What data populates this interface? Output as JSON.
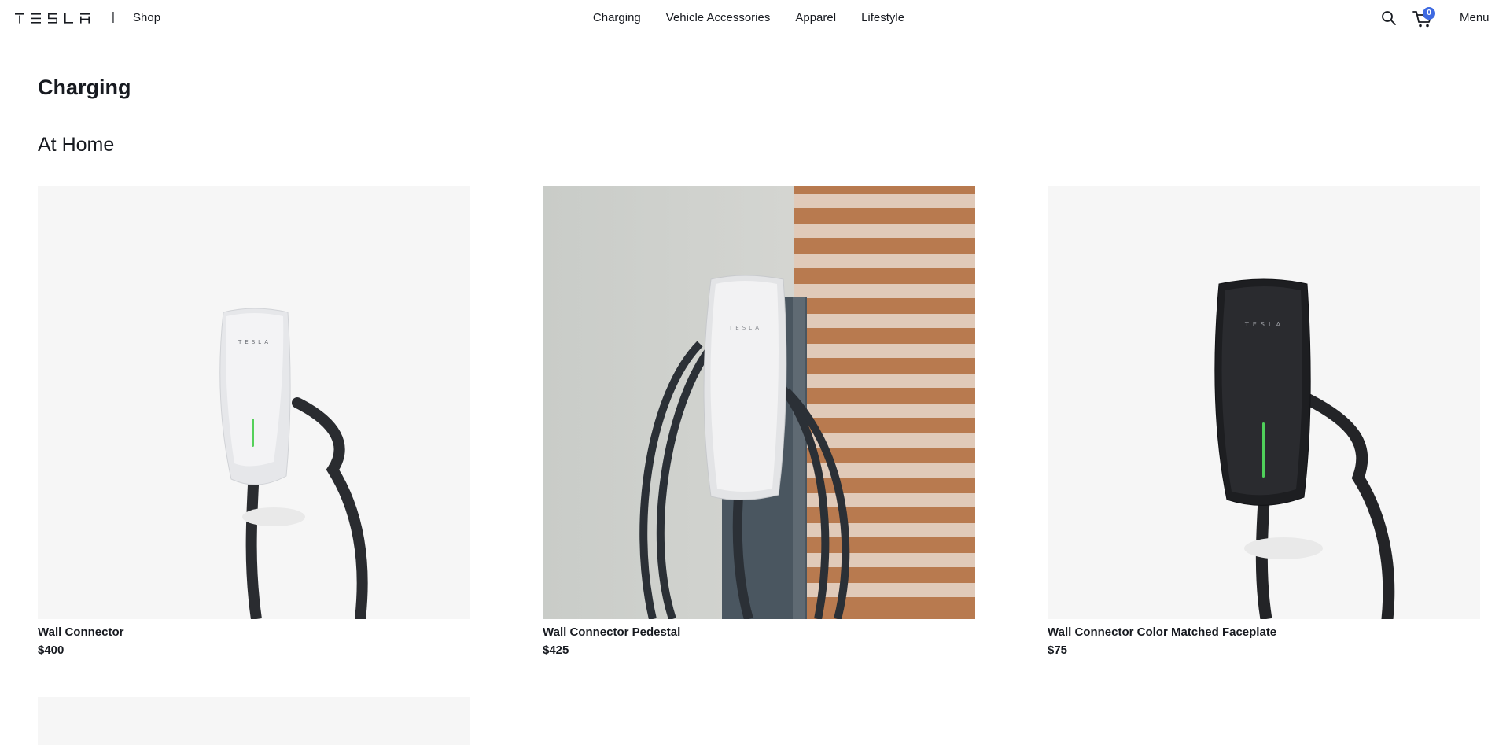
{
  "header": {
    "logo": "TESLA",
    "divider": "|",
    "shop_label": "Shop",
    "nav": [
      {
        "label": "Charging"
      },
      {
        "label": "Vehicle Accessories"
      },
      {
        "label": "Apparel"
      },
      {
        "label": "Lifestyle"
      }
    ],
    "search_icon": "search-icon",
    "cart_icon": "cart-icon",
    "cart_count": "0",
    "menu_label": "Menu"
  },
  "page": {
    "title": "Charging",
    "section_title": "At Home"
  },
  "products": [
    {
      "name": "Wall Connector",
      "price": "$400",
      "image": "white-wall-connector"
    },
    {
      "name": "Wall Connector Pedestal",
      "price": "$425",
      "image": "wall-connector-pedestal"
    },
    {
      "name": "Wall Connector Color Matched Faceplate",
      "price": "$75",
      "image": "black-wall-connector"
    }
  ],
  "colors": {
    "text": "#171a20",
    "accent": "#3e6ae1",
    "card_bg": "#f6f6f6"
  }
}
